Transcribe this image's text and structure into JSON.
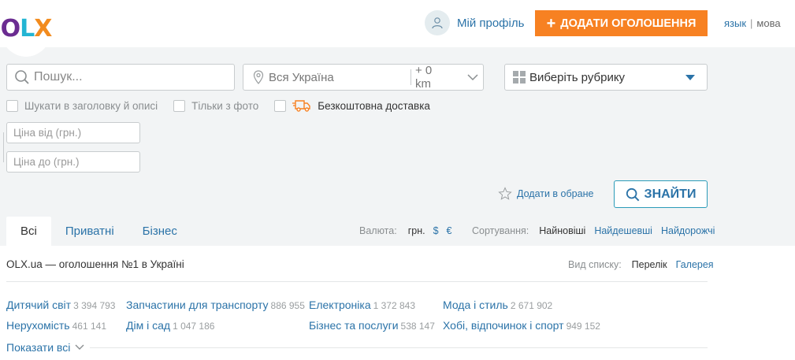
{
  "header": {
    "logo_text": "OLX",
    "profile_label": "Мій профіль",
    "add_button_label": "ДОДАТИ ОГОЛОШЕННЯ",
    "lang_ru": "язык",
    "lang_uk": "мова"
  },
  "search": {
    "query_placeholder": "Пошук...",
    "location_value": "Вся Україна",
    "radius_value": "+ 0 km",
    "category_value": "Виберіть рубрику",
    "check_title_desc": "Шукати в заголовку й описі",
    "check_photo": "Тільки з фото",
    "check_delivery": "Безкоштовна доставка",
    "price_from_placeholder": "Ціна від (грн.)",
    "price_to_placeholder": "Ціна до (грн.)",
    "favorite_label": "Додати в обране",
    "find_label": "ЗНАЙТИ"
  },
  "tabs": [
    {
      "label": "Всі",
      "active": true
    },
    {
      "label": "Приватні",
      "active": false
    },
    {
      "label": "Бізнес",
      "active": false
    }
  ],
  "currency": {
    "label": "Валюта:",
    "options": [
      "грн.",
      "$",
      "€"
    ],
    "selected": "грн."
  },
  "sort": {
    "label": "Сортування:",
    "options": [
      "Найновіші",
      "Найдешевші",
      "Найдорожчі"
    ],
    "selected": "Найновіші"
  },
  "main": {
    "page_title": "OLX.ua — оголошення №1 в Україні",
    "view_label": "Вид списку:",
    "view_options": [
      "Перелік",
      "Галерея"
    ],
    "view_selected": "Перелік",
    "show_all_label": "Показати всі"
  },
  "categories": [
    {
      "name": "Дитячий світ",
      "count": "3 394 793"
    },
    {
      "name": "Запчастини для транспорту",
      "count": "886 955"
    },
    {
      "name": "Електроніка",
      "count": "1 372 843"
    },
    {
      "name": "Мода і стиль",
      "count": "2 671 902"
    },
    {
      "name": "Нерухомість",
      "count": "461 141"
    },
    {
      "name": "Дім і сад",
      "count": "1 047 186"
    },
    {
      "name": "Бізнес та послуги",
      "count": "538 147"
    },
    {
      "name": "Хобі, відпочинок і спорт",
      "count": "949 152"
    }
  ],
  "colors": {
    "accent_orange": "#f78122",
    "link_blue": "#2b73a8",
    "filter_bg": "#f2f4f5",
    "logo_purple": "#6b2c91",
    "logo_cyan": "#23b5d3",
    "logo_orange": "#f28b1e"
  },
  "icons": {
    "profile": "user-icon",
    "search": "search-icon",
    "location": "map-pin-icon",
    "radius_dropdown": "chevron-down-icon",
    "category_grid": "grid-icon",
    "category_dropdown": "triangle-down-icon",
    "delivery": "truck-icon",
    "favorite": "star-icon",
    "show_all": "chevron-down-icon"
  }
}
